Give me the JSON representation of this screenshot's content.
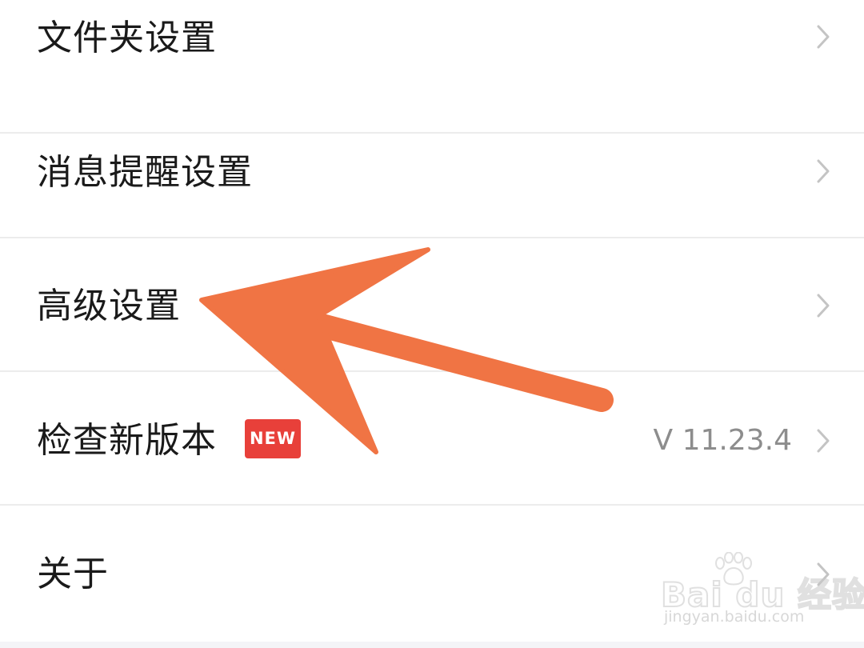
{
  "settings": {
    "items": [
      {
        "label": "文件夹设置"
      },
      {
        "label": "消息提醒设置"
      },
      {
        "label": "高级设置"
      },
      {
        "label": "检查新版本",
        "badge": "NEW",
        "value": "V 11.23.4"
      },
      {
        "label": "关于"
      }
    ]
  },
  "annotation": {
    "arrow_color": "#f07444"
  },
  "watermark": {
    "brand": "Bai du 经验",
    "url": "jingyan.baidu.com"
  },
  "icons": {
    "row_chevron": "chevron-right-icon",
    "watermark_logo": "paw-icon"
  },
  "colors": {
    "background": "#ffffff",
    "divider": "#ececec",
    "text": "#1a1a1a",
    "secondary_text": "#8d8d8d",
    "badge": "#e8403a",
    "chevron": "#c4c4c4"
  }
}
